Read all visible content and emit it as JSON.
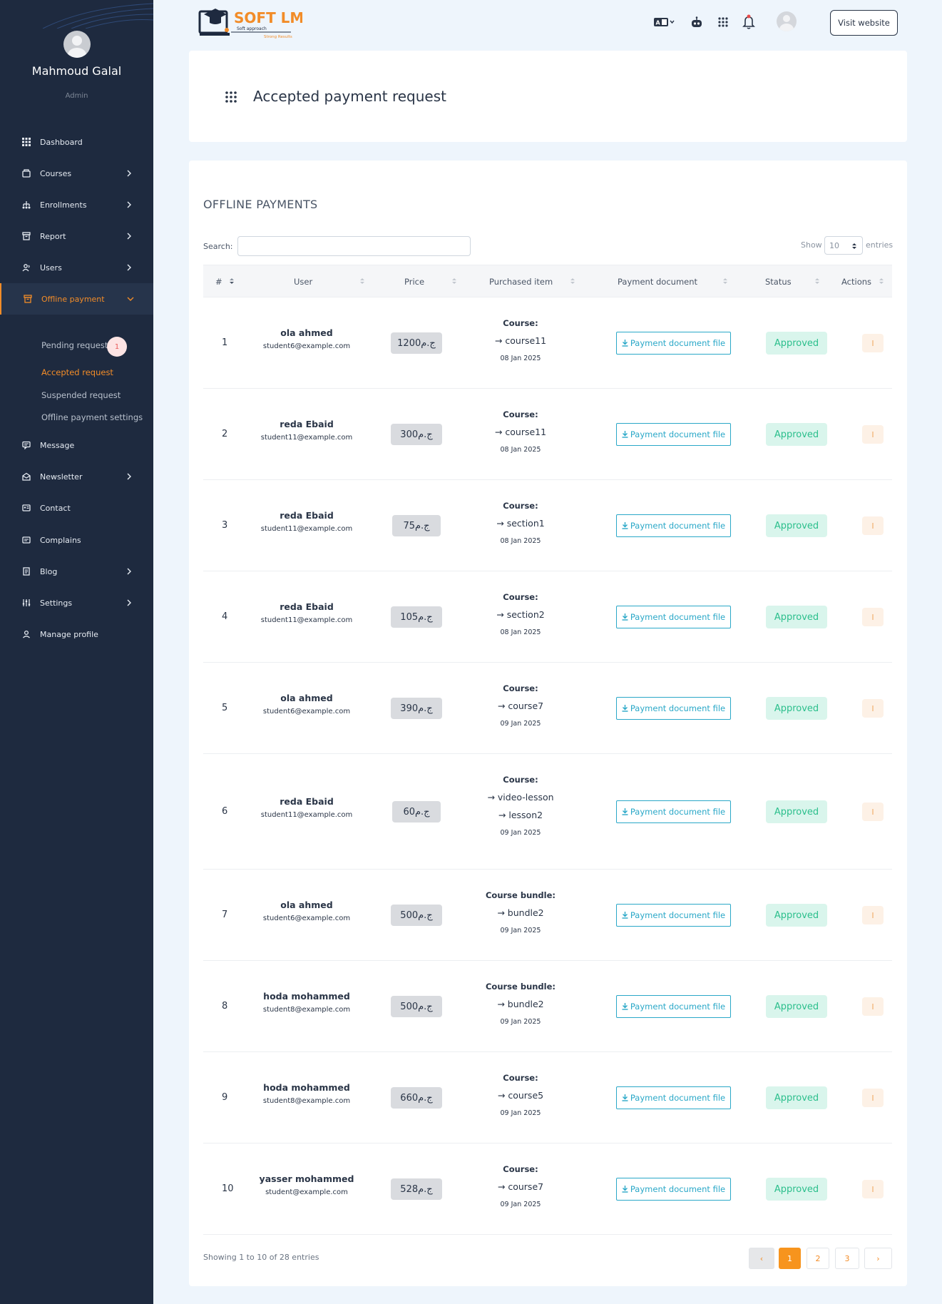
{
  "user": {
    "name": "Mahmoud Galal",
    "role": "Admin"
  },
  "sidebar": {
    "items": [
      {
        "label": "Dashboard",
        "icon": "dashboard-icon"
      },
      {
        "label": "Courses",
        "icon": "courses-icon"
      },
      {
        "label": "Enrollments",
        "icon": "enrollments-icon"
      },
      {
        "label": "Report",
        "icon": "report-icon"
      },
      {
        "label": "Users",
        "icon": "users-icon"
      },
      {
        "label": "Offline payment",
        "icon": "offline-payment-icon"
      },
      {
        "label": "Message",
        "icon": "message-icon"
      },
      {
        "label": "Newsletter",
        "icon": "newsletter-icon"
      },
      {
        "label": "Contact",
        "icon": "contact-icon"
      },
      {
        "label": "Complains",
        "icon": "complains-icon"
      },
      {
        "label": "Blog",
        "icon": "blog-icon"
      },
      {
        "label": "Settings",
        "icon": "settings-icon"
      },
      {
        "label": "Manage profile",
        "icon": "profile-icon"
      }
    ],
    "submenu": [
      {
        "label": "Pending request",
        "badge": "1"
      },
      {
        "label": "Accepted request"
      },
      {
        "label": "Suspended request"
      },
      {
        "label": "Offline payment settings"
      }
    ]
  },
  "topbar": {
    "logo_text": "SOFT LMS",
    "logo_tagline_1": "Soft approach",
    "logo_tagline_2": "Strong Results",
    "visit_label": "Visit website"
  },
  "page": {
    "title": "Accepted payment request"
  },
  "table": {
    "section_title": "OFFLINE PAYMENTS",
    "search_label": "Search:",
    "search_value": "",
    "show_label": "Show",
    "show_value": "10",
    "entries_label": "entries",
    "columns": [
      "#",
      "User",
      "Price",
      "Purchased item",
      "Payment document",
      "Status",
      "Actions"
    ],
    "doc_label": "Payment document file",
    "rows": [
      {
        "num": "1",
        "name": "ola ahmed",
        "email": "student6@example.com",
        "price": "1200ج.م",
        "kind": "Course:",
        "items": [
          "course11"
        ],
        "date": "08 Jan 2025",
        "status": "Approved"
      },
      {
        "num": "2",
        "name": "reda Ebaid",
        "email": "student11@example.com",
        "price": "300ج.م",
        "kind": "Course:",
        "items": [
          "course11"
        ],
        "date": "08 Jan 2025",
        "status": "Approved"
      },
      {
        "num": "3",
        "name": "reda Ebaid",
        "email": "student11@example.com",
        "price": "75ج.م",
        "kind": "Course:",
        "items": [
          "section1"
        ],
        "date": "08 Jan 2025",
        "status": "Approved"
      },
      {
        "num": "4",
        "name": "reda Ebaid",
        "email": "student11@example.com",
        "price": "105ج.م",
        "kind": "Course:",
        "items": [
          "section2"
        ],
        "date": "08 Jan 2025",
        "status": "Approved"
      },
      {
        "num": "5",
        "name": "ola ahmed",
        "email": "student6@example.com",
        "price": "390ج.م",
        "kind": "Course:",
        "items": [
          "course7"
        ],
        "date": "09 Jan 2025",
        "status": "Approved"
      },
      {
        "num": "6",
        "name": "reda Ebaid",
        "email": "student11@example.com",
        "price": "60ج.م",
        "kind": "Course:",
        "items": [
          "video-lesson",
          "lesson2"
        ],
        "date": "09 Jan 2025",
        "status": "Approved"
      },
      {
        "num": "7",
        "name": "ola ahmed",
        "email": "student6@example.com",
        "price": "500ج.م",
        "kind": "Course bundle:",
        "items": [
          "bundle2"
        ],
        "date": "09 Jan 2025",
        "status": "Approved"
      },
      {
        "num": "8",
        "name": "hoda mohammed",
        "email": "student8@example.com",
        "price": "500ج.م",
        "kind": "Course bundle:",
        "items": [
          "bundle2"
        ],
        "date": "09 Jan 2025",
        "status": "Approved"
      },
      {
        "num": "9",
        "name": "hoda mohammed",
        "email": "student8@example.com",
        "price": "660ج.م",
        "kind": "Course:",
        "items": [
          "course5"
        ],
        "date": "09 Jan 2025",
        "status": "Approved"
      },
      {
        "num": "10",
        "name": "yasser mohammed",
        "email": "student@example.com",
        "price": "528ج.م",
        "kind": "Course:",
        "items": [
          "course7"
        ],
        "date": "09 Jan 2025",
        "status": "Approved"
      }
    ],
    "footer": "Showing 1 to 10 of 28 entries",
    "pagination": {
      "prev": "‹",
      "pages": [
        "1",
        "2",
        "3"
      ],
      "next": "›"
    }
  },
  "colors": {
    "sidebar_bg": "#1e2a3f",
    "accent": "#f28c28",
    "approved": "#2bbf8c",
    "doc_link": "#2aa8c8"
  }
}
